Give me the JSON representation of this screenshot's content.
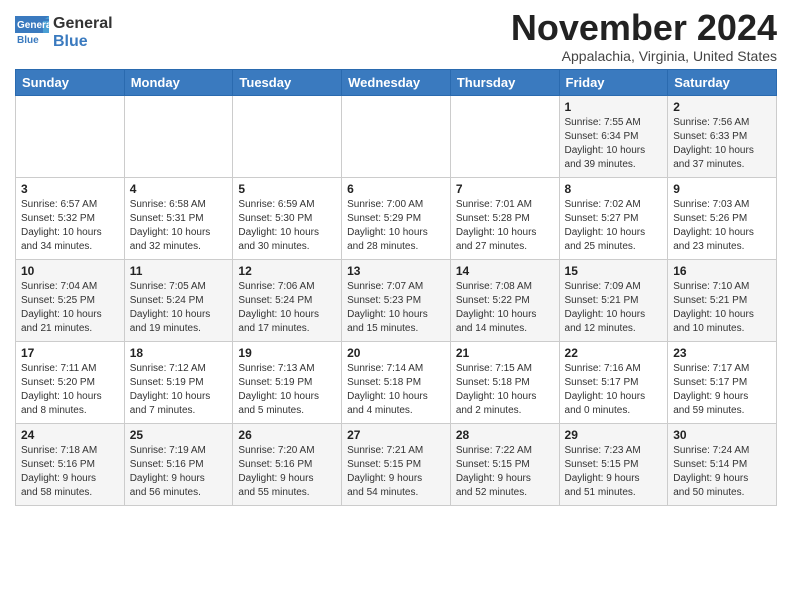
{
  "header": {
    "logo_line1": "General",
    "logo_line2": "Blue",
    "month_title": "November 2024",
    "location": "Appalachia, Virginia, United States"
  },
  "weekdays": [
    "Sunday",
    "Monday",
    "Tuesday",
    "Wednesday",
    "Thursday",
    "Friday",
    "Saturday"
  ],
  "weeks": [
    [
      {
        "day": "",
        "content": ""
      },
      {
        "day": "",
        "content": ""
      },
      {
        "day": "",
        "content": ""
      },
      {
        "day": "",
        "content": ""
      },
      {
        "day": "",
        "content": ""
      },
      {
        "day": "1",
        "content": "Sunrise: 7:55 AM\nSunset: 6:34 PM\nDaylight: 10 hours\nand 39 minutes."
      },
      {
        "day": "2",
        "content": "Sunrise: 7:56 AM\nSunset: 6:33 PM\nDaylight: 10 hours\nand 37 minutes."
      }
    ],
    [
      {
        "day": "3",
        "content": "Sunrise: 6:57 AM\nSunset: 5:32 PM\nDaylight: 10 hours\nand 34 minutes."
      },
      {
        "day": "4",
        "content": "Sunrise: 6:58 AM\nSunset: 5:31 PM\nDaylight: 10 hours\nand 32 minutes."
      },
      {
        "day": "5",
        "content": "Sunrise: 6:59 AM\nSunset: 5:30 PM\nDaylight: 10 hours\nand 30 minutes."
      },
      {
        "day": "6",
        "content": "Sunrise: 7:00 AM\nSunset: 5:29 PM\nDaylight: 10 hours\nand 28 minutes."
      },
      {
        "day": "7",
        "content": "Sunrise: 7:01 AM\nSunset: 5:28 PM\nDaylight: 10 hours\nand 27 minutes."
      },
      {
        "day": "8",
        "content": "Sunrise: 7:02 AM\nSunset: 5:27 PM\nDaylight: 10 hours\nand 25 minutes."
      },
      {
        "day": "9",
        "content": "Sunrise: 7:03 AM\nSunset: 5:26 PM\nDaylight: 10 hours\nand 23 minutes."
      }
    ],
    [
      {
        "day": "10",
        "content": "Sunrise: 7:04 AM\nSunset: 5:25 PM\nDaylight: 10 hours\nand 21 minutes."
      },
      {
        "day": "11",
        "content": "Sunrise: 7:05 AM\nSunset: 5:24 PM\nDaylight: 10 hours\nand 19 minutes."
      },
      {
        "day": "12",
        "content": "Sunrise: 7:06 AM\nSunset: 5:24 PM\nDaylight: 10 hours\nand 17 minutes."
      },
      {
        "day": "13",
        "content": "Sunrise: 7:07 AM\nSunset: 5:23 PM\nDaylight: 10 hours\nand 15 minutes."
      },
      {
        "day": "14",
        "content": "Sunrise: 7:08 AM\nSunset: 5:22 PM\nDaylight: 10 hours\nand 14 minutes."
      },
      {
        "day": "15",
        "content": "Sunrise: 7:09 AM\nSunset: 5:21 PM\nDaylight: 10 hours\nand 12 minutes."
      },
      {
        "day": "16",
        "content": "Sunrise: 7:10 AM\nSunset: 5:21 PM\nDaylight: 10 hours\nand 10 minutes."
      }
    ],
    [
      {
        "day": "17",
        "content": "Sunrise: 7:11 AM\nSunset: 5:20 PM\nDaylight: 10 hours\nand 8 minutes."
      },
      {
        "day": "18",
        "content": "Sunrise: 7:12 AM\nSunset: 5:19 PM\nDaylight: 10 hours\nand 7 minutes."
      },
      {
        "day": "19",
        "content": "Sunrise: 7:13 AM\nSunset: 5:19 PM\nDaylight: 10 hours\nand 5 minutes."
      },
      {
        "day": "20",
        "content": "Sunrise: 7:14 AM\nSunset: 5:18 PM\nDaylight: 10 hours\nand 4 minutes."
      },
      {
        "day": "21",
        "content": "Sunrise: 7:15 AM\nSunset: 5:18 PM\nDaylight: 10 hours\nand 2 minutes."
      },
      {
        "day": "22",
        "content": "Sunrise: 7:16 AM\nSunset: 5:17 PM\nDaylight: 10 hours\nand 0 minutes."
      },
      {
        "day": "23",
        "content": "Sunrise: 7:17 AM\nSunset: 5:17 PM\nDaylight: 9 hours\nand 59 minutes."
      }
    ],
    [
      {
        "day": "24",
        "content": "Sunrise: 7:18 AM\nSunset: 5:16 PM\nDaylight: 9 hours\nand 58 minutes."
      },
      {
        "day": "25",
        "content": "Sunrise: 7:19 AM\nSunset: 5:16 PM\nDaylight: 9 hours\nand 56 minutes."
      },
      {
        "day": "26",
        "content": "Sunrise: 7:20 AM\nSunset: 5:16 PM\nDaylight: 9 hours\nand 55 minutes."
      },
      {
        "day": "27",
        "content": "Sunrise: 7:21 AM\nSunset: 5:15 PM\nDaylight: 9 hours\nand 54 minutes."
      },
      {
        "day": "28",
        "content": "Sunrise: 7:22 AM\nSunset: 5:15 PM\nDaylight: 9 hours\nand 52 minutes."
      },
      {
        "day": "29",
        "content": "Sunrise: 7:23 AM\nSunset: 5:15 PM\nDaylight: 9 hours\nand 51 minutes."
      },
      {
        "day": "30",
        "content": "Sunrise: 7:24 AM\nSunset: 5:14 PM\nDaylight: 9 hours\nand 50 minutes."
      }
    ]
  ]
}
